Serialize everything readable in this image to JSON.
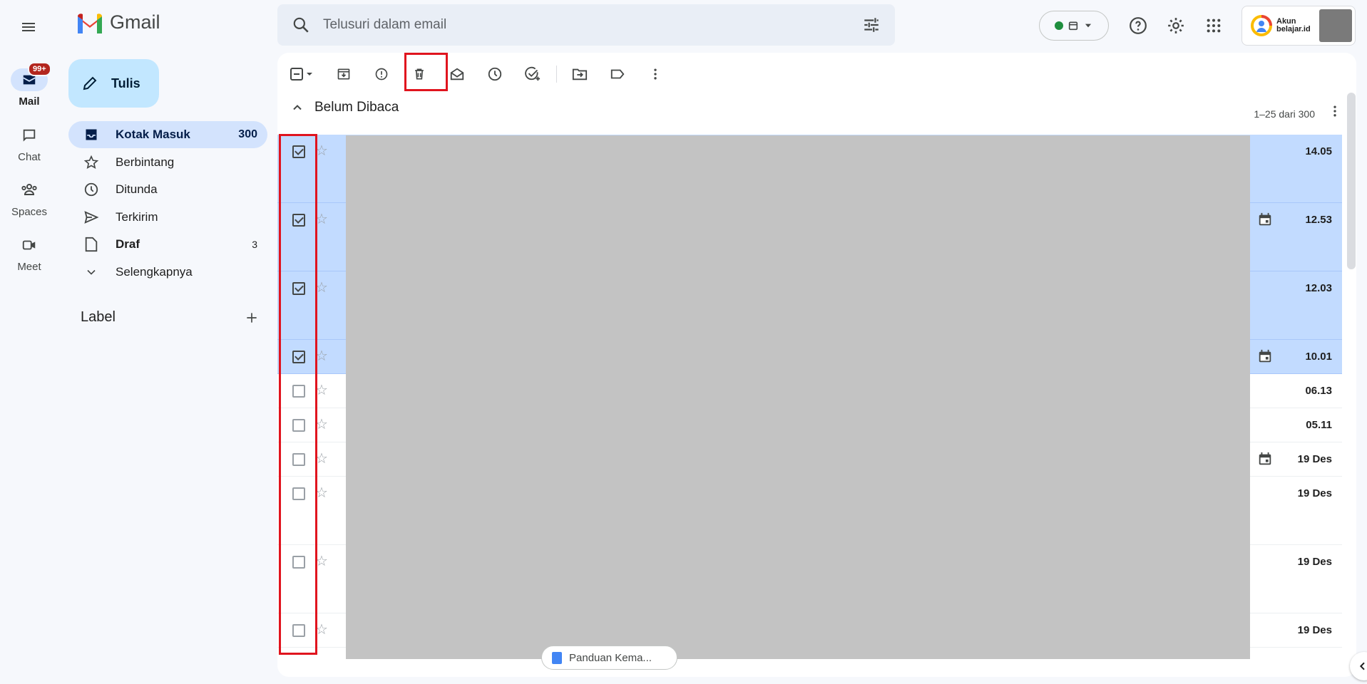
{
  "app": {
    "brand": "Gmail"
  },
  "rail": {
    "mail_badge": "99+",
    "items": [
      {
        "label": "Mail",
        "icon": "mail-icon"
      },
      {
        "label": "Chat",
        "icon": "chat-icon"
      },
      {
        "label": "Spaces",
        "icon": "spaces-icon"
      },
      {
        "label": "Meet",
        "icon": "meet-icon"
      }
    ]
  },
  "compose": {
    "label": "Tulis"
  },
  "nav": {
    "items": [
      {
        "label": "Kotak Masuk",
        "count": "300",
        "icon": "inbox-icon"
      },
      {
        "label": "Berbintang",
        "count": "",
        "icon": "star-icon"
      },
      {
        "label": "Ditunda",
        "count": "",
        "icon": "clock-icon"
      },
      {
        "label": "Terkirim",
        "count": "",
        "icon": "send-icon"
      },
      {
        "label": "Draf",
        "count": "3",
        "icon": "draft-icon"
      },
      {
        "label": "Selengkapnya",
        "count": "",
        "icon": "chevron-down-icon"
      }
    ],
    "labels_title": "Label"
  },
  "search": {
    "placeholder": "Telusuri dalam email"
  },
  "account": {
    "line1": "Akun",
    "line2": "belajar.id"
  },
  "inbox": {
    "section_title": "Belum Dibaca",
    "page_info": "1–25 dari 300",
    "rows": [
      {
        "time": "14.05",
        "selected": true,
        "calendar": false
      },
      {
        "time": "12.53",
        "selected": true,
        "calendar": true
      },
      {
        "time": "12.03",
        "selected": true,
        "calendar": false
      },
      {
        "time": "10.01",
        "selected": true,
        "calendar": true
      },
      {
        "time": "06.13",
        "selected": false,
        "calendar": false
      },
      {
        "time": "05.11",
        "selected": false,
        "calendar": false
      },
      {
        "time": "19 Des",
        "selected": false,
        "calendar": true
      },
      {
        "time": "19 Des",
        "selected": false,
        "calendar": false
      },
      {
        "time": "19 Des",
        "selected": false,
        "calendar": false
      },
      {
        "time": "19 Des",
        "selected": false,
        "calendar": false
      }
    ],
    "attachment_chip": "Panduan Kema..."
  },
  "colors": {
    "accent": "#c2e7ff",
    "selected_row": "#c2dbff",
    "highlight": "#e0141e"
  }
}
